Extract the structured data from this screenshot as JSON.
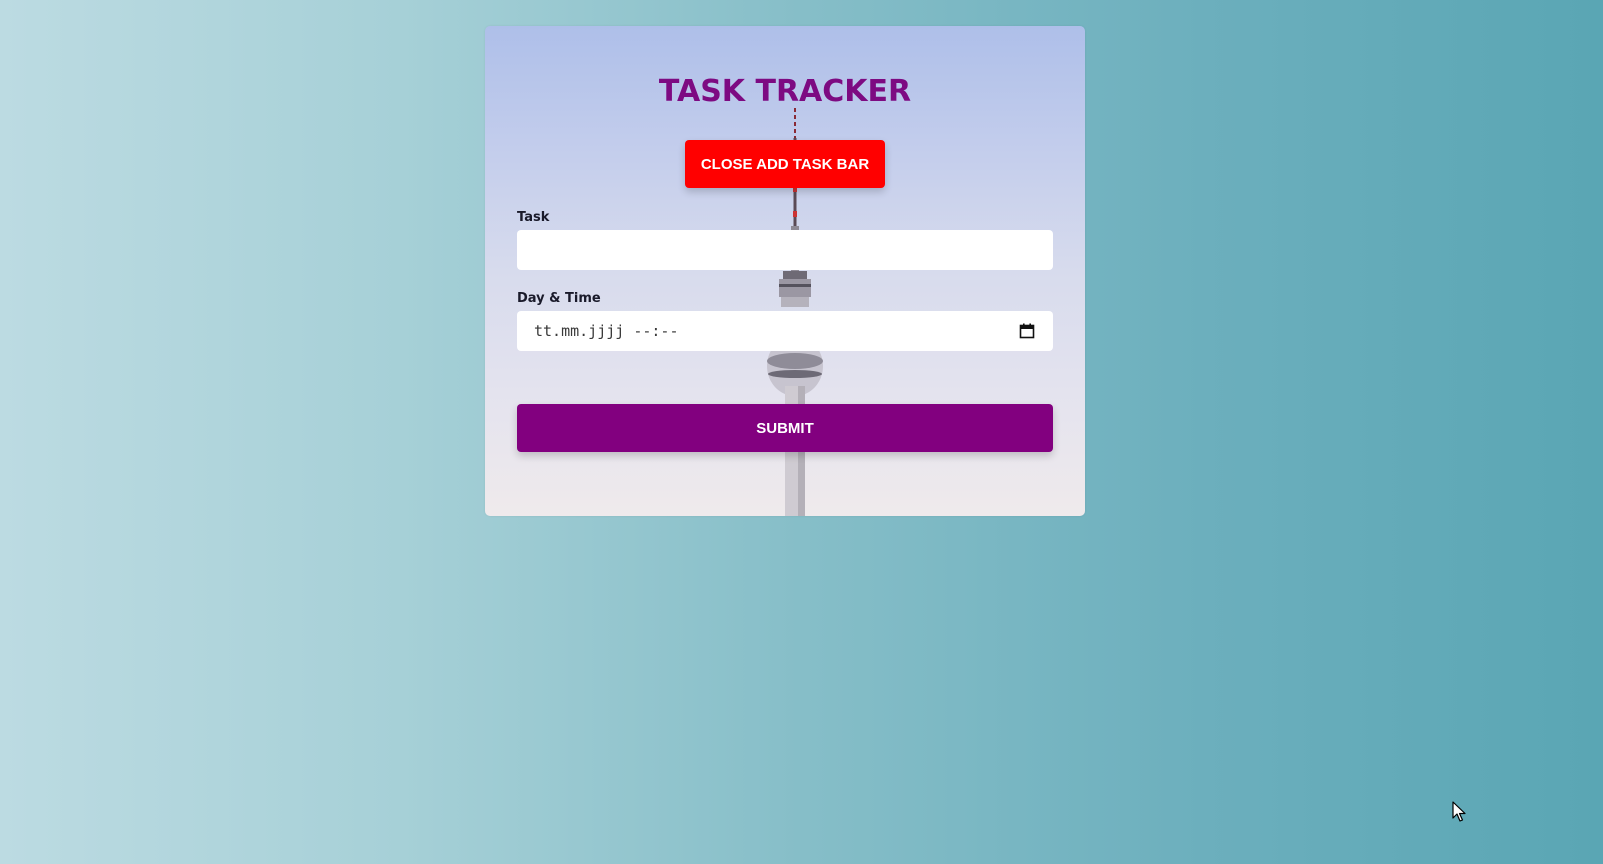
{
  "app": {
    "title": "TASK TRACKER"
  },
  "header": {
    "close_button_label": "CLOSE ADD TASK BAR"
  },
  "form": {
    "task_label": "Task",
    "task_value": "",
    "datetime_label": "Day & Time",
    "datetime_placeholder": "tt.mm.jjjj --:--",
    "submit_label": "SUBMIT"
  },
  "icons": {
    "calendar": "calendar-icon",
    "cursor": "mouse-pointer-icon"
  },
  "colors": {
    "title": "#7d0a82",
    "close_button": "#ff0000",
    "submit_button": "#82007f",
    "page_bg_left": "#bcdbe2",
    "page_bg_right": "#5aa6b4"
  }
}
